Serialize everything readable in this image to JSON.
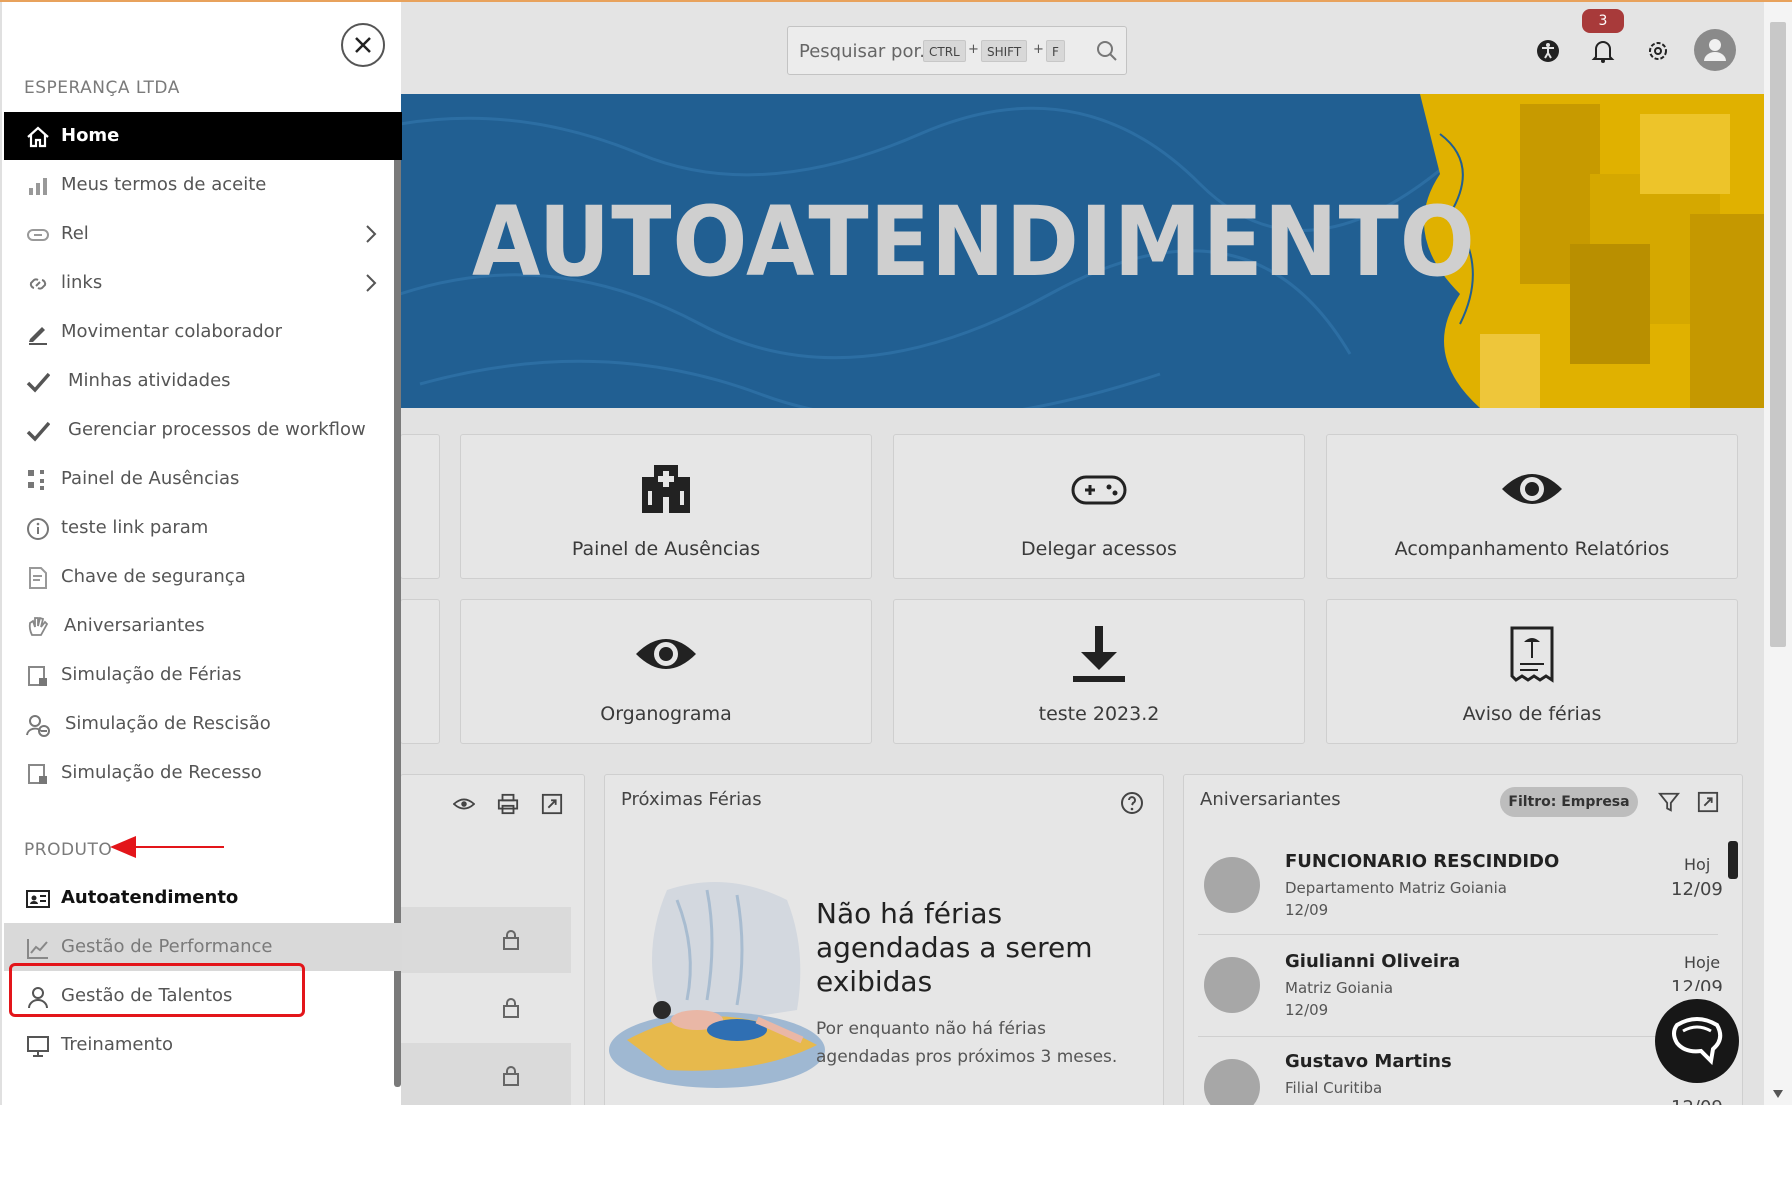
{
  "search": {
    "placeholder": "Pesquisar por...",
    "shortcut": [
      "CTRL",
      "SHIFT",
      "F"
    ],
    "plus": "+"
  },
  "topbar": {
    "notification_count": "3",
    "icons": [
      "accessibility-icon",
      "bell-icon",
      "gear-icon",
      "user-avatar-icon"
    ]
  },
  "banner": {
    "title": "AUTOATENDIMENTO"
  },
  "cards": [
    {
      "label": "Painel de Ausências",
      "icon": "hospital-icon"
    },
    {
      "label": "Delegar acessos",
      "icon": "gamepad-icon"
    },
    {
      "label": "Acompanhamento Relatórios",
      "icon": "eye-icon"
    },
    {
      "label": "Organograma",
      "icon": "eye-icon"
    },
    {
      "label": "teste 2023.2",
      "icon": "download-icon"
    },
    {
      "label": "Aviso de férias",
      "icon": "vacation-notice-icon"
    }
  ],
  "panels": {
    "proximas_ferias": {
      "title": "Próximas Férias",
      "empty_title": "Não há férias agendadas a serem exibidas",
      "empty_text": "Por enquanto não há férias agendadas pros próximos 3 meses."
    },
    "aniversariantes": {
      "title": "Aniversariantes",
      "filter_label": "Filtro: Empresa",
      "people": [
        {
          "name": "FUNCIONARIO RESCINDIDO",
          "dept": "Departamento Matriz Goiania",
          "date": "12/09",
          "when": "Hoj",
          "right_date": "12/09"
        },
        {
          "name": "Giulianni Oliveira",
          "dept": "Matriz Goiania",
          "date": "12/09",
          "when": "Hoje",
          "right_date": "12/09"
        },
        {
          "name": "Gustavo Martins",
          "dept": "Filial Curitiba",
          "date": "",
          "when": "",
          "right_date": "12/09"
        }
      ]
    }
  },
  "sidebar": {
    "company": "ESPERANÇA LTDA",
    "items": [
      {
        "label": "Home",
        "icon": "home-icon",
        "active": true
      },
      {
        "label": "Meus termos de aceite",
        "icon": "chart-icon"
      },
      {
        "label": "Rel",
        "icon": "link-box-icon",
        "submenu": true
      },
      {
        "label": "links",
        "icon": "link-icon",
        "submenu": true
      },
      {
        "label": "Movimentar colaborador",
        "icon": "pen-icon"
      },
      {
        "label": "Minhas atividades",
        "icon": "check-icon"
      },
      {
        "label": "Gerenciar processos de workflow",
        "icon": "check-icon"
      },
      {
        "label": "Painel de Ausências",
        "icon": "grid-icon"
      },
      {
        "label": "teste link param",
        "icon": "info-icon"
      },
      {
        "label": "Chave de segurança",
        "icon": "document-edit-icon"
      },
      {
        "label": "Aniversariantes",
        "icon": "hand-icon"
      },
      {
        "label": "Simulação de Férias",
        "icon": "calendar-file-icon"
      },
      {
        "label": "Simulação de Rescisão",
        "icon": "user-minus-icon"
      },
      {
        "label": "Simulação de Recesso",
        "icon": "calendar-file-icon"
      }
    ],
    "product_label": "PRODUTO",
    "products": [
      {
        "label": "Autoatendimento",
        "icon": "id-card-icon",
        "bold": true
      },
      {
        "label": "Gestão de Performance",
        "icon": "trend-icon",
        "hover": true
      },
      {
        "label": "Gestão de Talentos",
        "icon": "person-icon",
        "highlighted": true
      },
      {
        "label": "Treinamento",
        "icon": "monitor-icon"
      }
    ]
  },
  "colors": {
    "accent_red": "#e3151a",
    "sidebar_active": "#000000",
    "banner_blue": "#215f92",
    "banner_yellow": "#e0b100"
  }
}
